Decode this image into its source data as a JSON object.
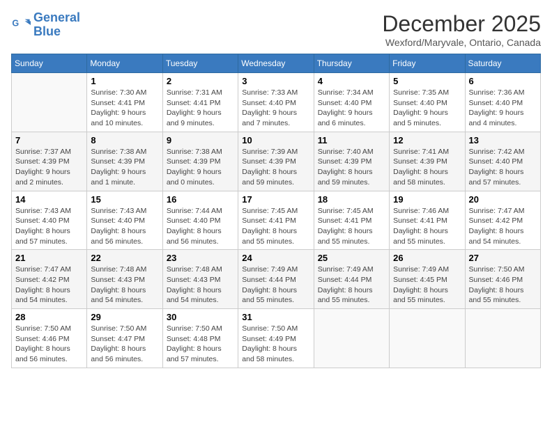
{
  "logo": {
    "line1": "General",
    "line2": "Blue"
  },
  "title": "December 2025",
  "subtitle": "Wexford/Maryvale, Ontario, Canada",
  "weekdays": [
    "Sunday",
    "Monday",
    "Tuesday",
    "Wednesday",
    "Thursday",
    "Friday",
    "Saturday"
  ],
  "weeks": [
    [
      {
        "day": "",
        "info": ""
      },
      {
        "day": "1",
        "info": "Sunrise: 7:30 AM\nSunset: 4:41 PM\nDaylight: 9 hours\nand 10 minutes."
      },
      {
        "day": "2",
        "info": "Sunrise: 7:31 AM\nSunset: 4:41 PM\nDaylight: 9 hours\nand 9 minutes."
      },
      {
        "day": "3",
        "info": "Sunrise: 7:33 AM\nSunset: 4:40 PM\nDaylight: 9 hours\nand 7 minutes."
      },
      {
        "day": "4",
        "info": "Sunrise: 7:34 AM\nSunset: 4:40 PM\nDaylight: 9 hours\nand 6 minutes."
      },
      {
        "day": "5",
        "info": "Sunrise: 7:35 AM\nSunset: 4:40 PM\nDaylight: 9 hours\nand 5 minutes."
      },
      {
        "day": "6",
        "info": "Sunrise: 7:36 AM\nSunset: 4:40 PM\nDaylight: 9 hours\nand 4 minutes."
      }
    ],
    [
      {
        "day": "7",
        "info": "Sunrise: 7:37 AM\nSunset: 4:39 PM\nDaylight: 9 hours\nand 2 minutes."
      },
      {
        "day": "8",
        "info": "Sunrise: 7:38 AM\nSunset: 4:39 PM\nDaylight: 9 hours\nand 1 minute."
      },
      {
        "day": "9",
        "info": "Sunrise: 7:38 AM\nSunset: 4:39 PM\nDaylight: 9 hours\nand 0 minutes."
      },
      {
        "day": "10",
        "info": "Sunrise: 7:39 AM\nSunset: 4:39 PM\nDaylight: 8 hours\nand 59 minutes."
      },
      {
        "day": "11",
        "info": "Sunrise: 7:40 AM\nSunset: 4:39 PM\nDaylight: 8 hours\nand 59 minutes."
      },
      {
        "day": "12",
        "info": "Sunrise: 7:41 AM\nSunset: 4:39 PM\nDaylight: 8 hours\nand 58 minutes."
      },
      {
        "day": "13",
        "info": "Sunrise: 7:42 AM\nSunset: 4:40 PM\nDaylight: 8 hours\nand 57 minutes."
      }
    ],
    [
      {
        "day": "14",
        "info": "Sunrise: 7:43 AM\nSunset: 4:40 PM\nDaylight: 8 hours\nand 57 minutes."
      },
      {
        "day": "15",
        "info": "Sunrise: 7:43 AM\nSunset: 4:40 PM\nDaylight: 8 hours\nand 56 minutes."
      },
      {
        "day": "16",
        "info": "Sunrise: 7:44 AM\nSunset: 4:40 PM\nDaylight: 8 hours\nand 56 minutes."
      },
      {
        "day": "17",
        "info": "Sunrise: 7:45 AM\nSunset: 4:41 PM\nDaylight: 8 hours\nand 55 minutes."
      },
      {
        "day": "18",
        "info": "Sunrise: 7:45 AM\nSunset: 4:41 PM\nDaylight: 8 hours\nand 55 minutes."
      },
      {
        "day": "19",
        "info": "Sunrise: 7:46 AM\nSunset: 4:41 PM\nDaylight: 8 hours\nand 55 minutes."
      },
      {
        "day": "20",
        "info": "Sunrise: 7:47 AM\nSunset: 4:42 PM\nDaylight: 8 hours\nand 54 minutes."
      }
    ],
    [
      {
        "day": "21",
        "info": "Sunrise: 7:47 AM\nSunset: 4:42 PM\nDaylight: 8 hours\nand 54 minutes."
      },
      {
        "day": "22",
        "info": "Sunrise: 7:48 AM\nSunset: 4:43 PM\nDaylight: 8 hours\nand 54 minutes."
      },
      {
        "day": "23",
        "info": "Sunrise: 7:48 AM\nSunset: 4:43 PM\nDaylight: 8 hours\nand 54 minutes."
      },
      {
        "day": "24",
        "info": "Sunrise: 7:49 AM\nSunset: 4:44 PM\nDaylight: 8 hours\nand 55 minutes."
      },
      {
        "day": "25",
        "info": "Sunrise: 7:49 AM\nSunset: 4:44 PM\nDaylight: 8 hours\nand 55 minutes."
      },
      {
        "day": "26",
        "info": "Sunrise: 7:49 AM\nSunset: 4:45 PM\nDaylight: 8 hours\nand 55 minutes."
      },
      {
        "day": "27",
        "info": "Sunrise: 7:50 AM\nSunset: 4:46 PM\nDaylight: 8 hours\nand 55 minutes."
      }
    ],
    [
      {
        "day": "28",
        "info": "Sunrise: 7:50 AM\nSunset: 4:46 PM\nDaylight: 8 hours\nand 56 minutes."
      },
      {
        "day": "29",
        "info": "Sunrise: 7:50 AM\nSunset: 4:47 PM\nDaylight: 8 hours\nand 56 minutes."
      },
      {
        "day": "30",
        "info": "Sunrise: 7:50 AM\nSunset: 4:48 PM\nDaylight: 8 hours\nand 57 minutes."
      },
      {
        "day": "31",
        "info": "Sunrise: 7:50 AM\nSunset: 4:49 PM\nDaylight: 8 hours\nand 58 minutes."
      },
      {
        "day": "",
        "info": ""
      },
      {
        "day": "",
        "info": ""
      },
      {
        "day": "",
        "info": ""
      }
    ]
  ]
}
